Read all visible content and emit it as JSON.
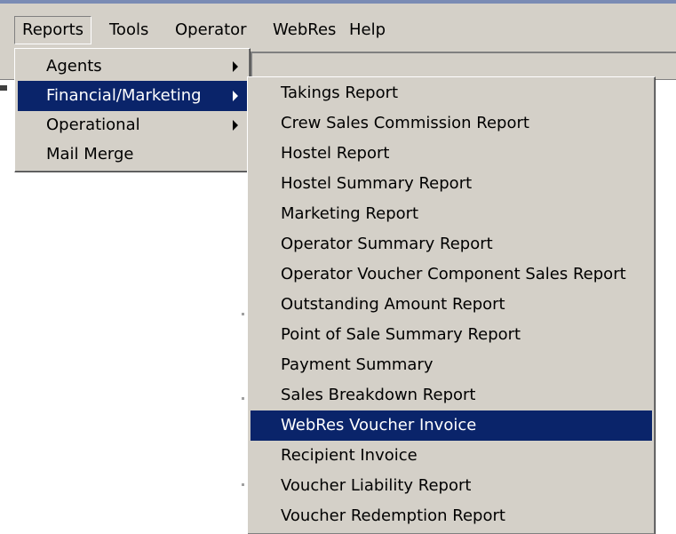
{
  "menubar": {
    "items": [
      {
        "label": "Reports"
      },
      {
        "label": "Tools"
      },
      {
        "label": "Operator"
      },
      {
        "label": "WebRes"
      },
      {
        "label": "Help"
      }
    ]
  },
  "reports_menu": {
    "items": [
      {
        "label": "Agents"
      },
      {
        "label": "Financial/Marketing"
      },
      {
        "label": "Operational"
      },
      {
        "label": "Mail Merge"
      }
    ]
  },
  "financial_submenu": {
    "items": [
      {
        "label": "Takings Report"
      },
      {
        "label": "Crew Sales Commission Report"
      },
      {
        "label": "Hostel Report"
      },
      {
        "label": "Hostel Summary Report"
      },
      {
        "label": "Marketing Report"
      },
      {
        "label": "Operator Summary Report"
      },
      {
        "label": "Operator Voucher Component Sales Report"
      },
      {
        "label": "Outstanding Amount Report"
      },
      {
        "label": "Point of Sale Summary Report"
      },
      {
        "label": "Payment Summary"
      },
      {
        "label": "Sales Breakdown Report"
      },
      {
        "label": "WebRes Voucher Invoice"
      },
      {
        "label": "Recipient Invoice"
      },
      {
        "label": "Voucher Liability Report"
      },
      {
        "label": "Voucher Redemption Report"
      }
    ]
  },
  "colors": {
    "menu_background": "#d4d0c8",
    "selection": "#0a246a",
    "selection_text": "#ffffff"
  }
}
